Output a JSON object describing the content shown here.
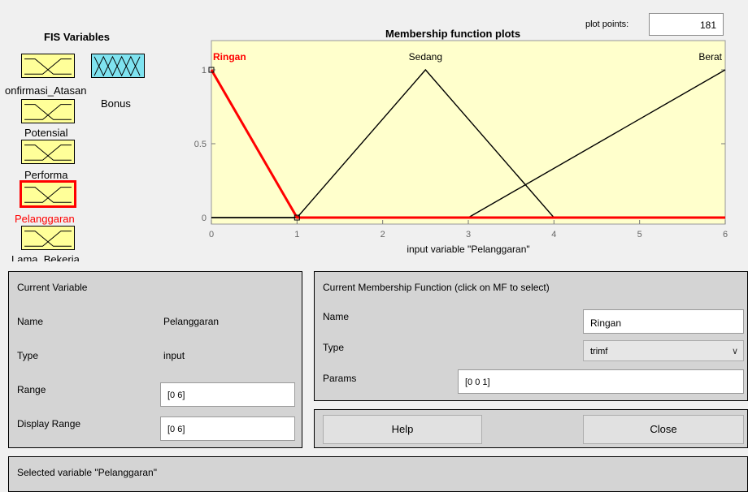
{
  "fis_variables": {
    "title": "FIS Variables",
    "variables": [
      {
        "label": "onfirmasi_Atasan",
        "kind": "input"
      },
      {
        "label": "Potensial",
        "kind": "input"
      },
      {
        "label": "Performa",
        "kind": "input"
      },
      {
        "label": "Pelanggaran",
        "kind": "input",
        "selected": true
      },
      {
        "label": "Lama_Bekerja",
        "kind": "input"
      },
      {
        "label": "Bonus",
        "kind": "output"
      }
    ]
  },
  "plot": {
    "title": "Membership function plots",
    "plot_points_label": "plot points:",
    "plot_points_value": "181",
    "xlabel": "input variable \"Pelanggaran\"",
    "x_ticks": [
      "0",
      "1",
      "2",
      "3",
      "4",
      "5",
      "6"
    ],
    "y_ticks": [
      "0",
      "0.5",
      "1"
    ]
  },
  "chart_data": {
    "type": "line",
    "xlim": [
      0,
      6
    ],
    "ylim": [
      0,
      1.2
    ],
    "series": [
      {
        "name": "Ringan",
        "params": [
          0,
          0,
          1
        ],
        "x": [
          0,
          0,
          1,
          6
        ],
        "y": [
          1,
          1,
          0,
          0
        ],
        "color": "#ff0000",
        "selected": true
      },
      {
        "name": "Sedang",
        "params": [
          1,
          2.5,
          4
        ],
        "x": [
          0,
          1,
          2.5,
          4,
          6
        ],
        "y": [
          0,
          0,
          1,
          0,
          0
        ],
        "color": "#000000"
      },
      {
        "name": "Berat",
        "params": [
          3,
          6,
          6
        ],
        "x": [
          0,
          3,
          6
        ],
        "y": [
          0,
          0,
          1
        ],
        "color": "#000000"
      }
    ]
  },
  "current_variable": {
    "title": "Current Variable",
    "name_label": "Name",
    "name_value": "Pelanggaran",
    "type_label": "Type",
    "type_value": "input",
    "range_label": "Range",
    "range_value": "[0 6]",
    "display_range_label": "Display Range",
    "display_range_value": "[0 6]"
  },
  "current_mf": {
    "title": "Current Membership Function (click on MF to select)",
    "name_label": "Name",
    "name_value": "Ringan",
    "type_label": "Type",
    "type_value": "trimf",
    "params_label": "Params",
    "params_value": "[0 0 1]"
  },
  "buttons": {
    "help": "Help",
    "close": "Close"
  },
  "status": {
    "text": "Selected variable \"Pelanggaran\""
  },
  "colors": {
    "plot_bg": "#ffffcc",
    "selected_mf": "#ff0000",
    "input_box": "#ffff99",
    "output_box": "#7fe3f0"
  }
}
